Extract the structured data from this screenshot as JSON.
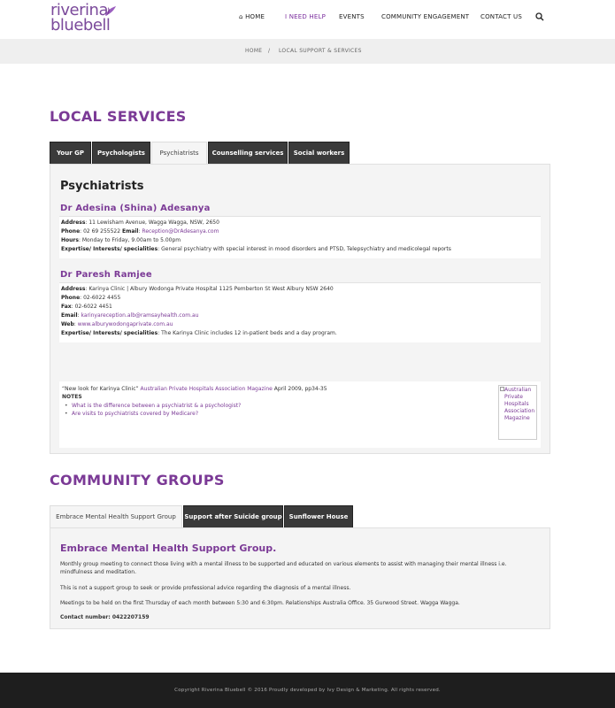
{
  "logo": {
    "line1": "riverina",
    "line2": "bluebell"
  },
  "nav": {
    "home": "HOME",
    "need_help": "I NEED HELP",
    "events": "EVENTS",
    "community": "COMMUNITY ENGAGEMENT",
    "contact": "CONTACT US"
  },
  "breadcrumb": {
    "home": "HOME",
    "sep": "/",
    "current": "LOCAL SUPPORT & SERVICES"
  },
  "local_services": {
    "title": "LOCAL SERVICES",
    "tabs": [
      "Your GP",
      "Psychologists",
      "Psychiatrists",
      "Counselling services",
      "Social workers"
    ],
    "panel_title": "Psychiatrists",
    "doctors": [
      {
        "name": "Dr Adesina (Shina) Adesanya",
        "address_label": "Address",
        "address": ": 11 Lewisham Avenue, Wagga Wagga, NSW, 2650",
        "phone_label": "Phone",
        "phone": ": 02 69 255522 ",
        "email_label": "Email",
        "email": "Reception@DrAdesanya.com",
        "hours_label": "Hours",
        "hours": ": Monday to Friday, 9.00am to 5.00pm",
        "expertise_label": "Expertise/ Interests/ specialities",
        "expertise": ": General psychiatry with special interest in mood disorders and PTSD, Telepsychiatry and medicolegal reports"
      },
      {
        "name": "Dr Paresh Ramjee",
        "address_label": "Address",
        "address": ": Karinya Clinic | Albury Wodonga Private Hospital 1125 Pemberton St West Albury NSW 2640",
        "phone_label": "Phone",
        "phone": ": 02-6022 4455",
        "fax_label": "Fax",
        "fax": ": 02-6022 4451",
        "email_label": "Email",
        "email": "karinyareception.alb@ramsayhealth.com.au",
        "web_label": "Web",
        "web": "www.alburywodongaprivate.com.au",
        "expertise_label": "Expertise/ Interests/ specialities",
        "expertise": ": The Karinya Clinic includes 12 in-patient beds and a day program."
      }
    ],
    "notes": {
      "citation_pre": "“New look for Karinya Clinic” ",
      "citation_link": "Australian Private Hospitals Association Magazine",
      "citation_post": " April 2009, pp34-35",
      "label": "NOTES",
      "links": [
        "What is the difference between a psychiatrist & a psychologist?",
        "Are visits to psychiatrists covered by Medicare?"
      ],
      "image_alt": "Australian Private Hospitals Association Magazine"
    }
  },
  "community_groups": {
    "title": "COMMUNITY GROUPS",
    "tabs": [
      "Embrace Mental Health Support Group",
      "Support after Suicide group",
      "Sunflower House"
    ],
    "group_title": "Embrace Mental Health Support Group.",
    "para1": "Monthly group meeting to connect those living with a mental illness to be supported and educated on various elements to assist with managing their mental illness i.e. mindfulness and meditation.",
    "para2": "This is not a support group to seek or provide professional advice regarding the diagnosis of a mental illness.",
    "para3": "Meetings to be held on the first Thursday of each month between 5:30 and 6:30pm. Relationships Australia Office. 35 Gurwood Street. Wagga Wagga.",
    "contact": "Contact number: 0422207159"
  },
  "footer": {
    "text": "Copyright Riverina Bluebell © 2016 Proudly developed by Ivy Design & Marketing. All rights reserved."
  },
  "colors": {
    "brand": "#7b3a96",
    "tab_dark": "#3a3a3a",
    "footer": "#1e1e1e"
  },
  "icons": {
    "home": "home-icon",
    "search": "search-icon",
    "logo_flower": "bluebell-flower-icon"
  }
}
